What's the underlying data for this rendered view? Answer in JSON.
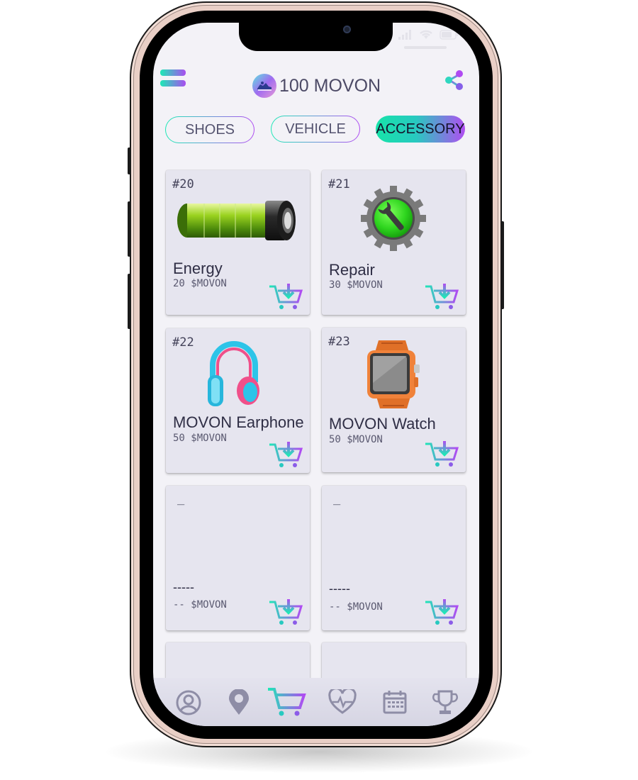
{
  "header": {
    "coin_icon": "running-shoe-coin-icon",
    "balance": "100 MOVON",
    "menu_icon": "menu-icon",
    "share_icon": "share-icon"
  },
  "tabs": [
    {
      "label": "SHOES",
      "active": false
    },
    {
      "label": "VEHICLE",
      "active": false
    },
    {
      "label": "ACCESSORY",
      "active": true
    }
  ],
  "items": [
    {
      "number": "#20",
      "name": "Energy",
      "price": "20 $MOVON",
      "icon": "battery-icon"
    },
    {
      "number": "#21",
      "name": "Repair",
      "price": "30 $MOVON",
      "icon": "wrench-gear-icon"
    },
    {
      "number": "#22",
      "name": "MOVON Earphone",
      "price": "50 $MOVON",
      "icon": "headphones-icon"
    },
    {
      "number": "#23",
      "name": "MOVON Watch",
      "price": "50 $MOVON",
      "icon": "smartwatch-icon"
    },
    {
      "number": "_",
      "name": "-----",
      "price": "-- $MOVON",
      "icon": ""
    },
    {
      "number": "_",
      "name": "-----",
      "price": "-- $MOVON",
      "icon": ""
    }
  ],
  "bottom_nav": [
    {
      "icon": "profile-icon",
      "active": false
    },
    {
      "icon": "location-pin-icon",
      "active": false
    },
    {
      "icon": "shopping-cart-icon",
      "active": true
    },
    {
      "icon": "heart-rate-icon",
      "active": false
    },
    {
      "icon": "calendar-icon",
      "active": false
    },
    {
      "icon": "trophy-icon",
      "active": false
    }
  ],
  "colors": {
    "accent_green": "#1de9b6",
    "accent_purple": "#b04bf2",
    "card_bg": "#e6e5ef",
    "text": "#4c4a66"
  }
}
